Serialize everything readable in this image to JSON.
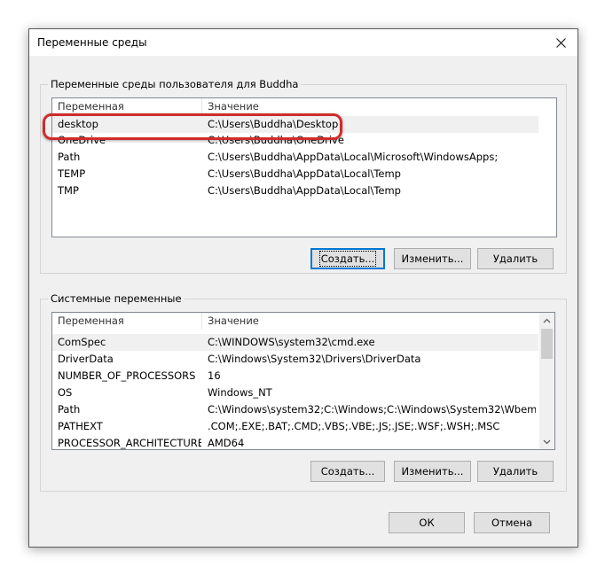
{
  "dialog": {
    "title": "Переменные среды",
    "close_icon": "close-icon"
  },
  "user_vars": {
    "group_title": "Переменные среды пользователя для Buddha",
    "columns": {
      "name": "Переменная",
      "value": "Значение"
    },
    "rows": [
      {
        "name": "desktop",
        "value": "C:\\Users\\Buddha\\Desktop"
      },
      {
        "name": "OneDrive",
        "value": "C:\\Users\\Buddha\\OneDrive"
      },
      {
        "name": "Path",
        "value": "C:\\Users\\Buddha\\AppData\\Local\\Microsoft\\WindowsApps;"
      },
      {
        "name": "TEMP",
        "value": "C:\\Users\\Buddha\\AppData\\Local\\Temp"
      },
      {
        "name": "TMP",
        "value": "C:\\Users\\Buddha\\AppData\\Local\\Temp"
      }
    ],
    "buttons": {
      "create": "Создать...",
      "edit": "Изменить...",
      "delete": "Удалить"
    }
  },
  "system_vars": {
    "group_title": "Системные переменные",
    "columns": {
      "name": "Переменная",
      "value": "Значение"
    },
    "rows": [
      {
        "name": "ComSpec",
        "value": "C:\\WINDOWS\\system32\\cmd.exe"
      },
      {
        "name": "DriverData",
        "value": "C:\\Windows\\System32\\Drivers\\DriverData"
      },
      {
        "name": "NUMBER_OF_PROCESSORS",
        "value": "16"
      },
      {
        "name": "OS",
        "value": "Windows_NT"
      },
      {
        "name": "Path",
        "value": "C:\\Windows\\system32;C:\\Windows;C:\\Windows\\System32\\Wbem;..."
      },
      {
        "name": "PATHEXT",
        "value": ".COM;.EXE;.BAT;.CMD;.VBS;.VBE;.JS;.JSE;.WSF;.WSH;.MSC"
      },
      {
        "name": "PROCESSOR_ARCHITECTURE",
        "value": "AMD64"
      }
    ],
    "buttons": {
      "create": "Создать...",
      "edit": "Изменить...",
      "delete": "Удалить"
    }
  },
  "footer": {
    "ok": "ОК",
    "cancel": "Отмена"
  },
  "colors": {
    "highlight": "#d02b2b",
    "focus_border": "#0078d7",
    "selection": "#f0f0f0"
  }
}
